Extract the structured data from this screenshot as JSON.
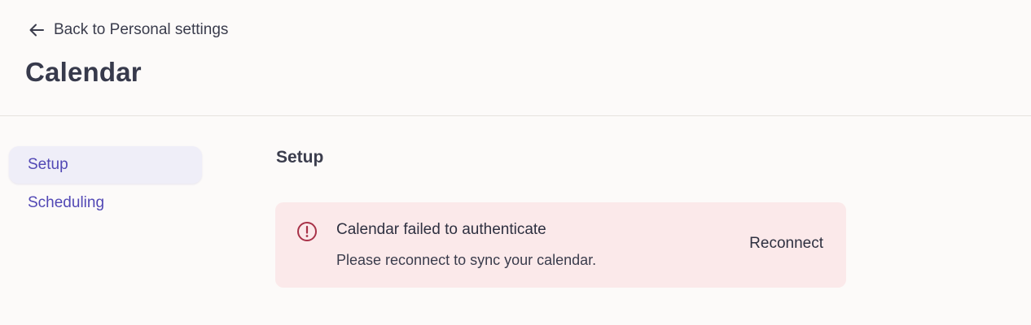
{
  "header": {
    "back_label": "Back to Personal settings",
    "title": "Calendar"
  },
  "sidebar": {
    "items": [
      {
        "label": "Setup",
        "active": true
      },
      {
        "label": "Scheduling",
        "active": false
      }
    ]
  },
  "main": {
    "section_title": "Setup",
    "alert": {
      "icon": "alert-circle-icon",
      "title": "Calendar failed to authenticate",
      "description": "Please reconnect to sync your calendar.",
      "action_label": "Reconnect",
      "color": "#a83248",
      "background": "#fbe9ea"
    }
  },
  "colors": {
    "accent": "#5248b5",
    "page_background": "#fcfaf9"
  }
}
